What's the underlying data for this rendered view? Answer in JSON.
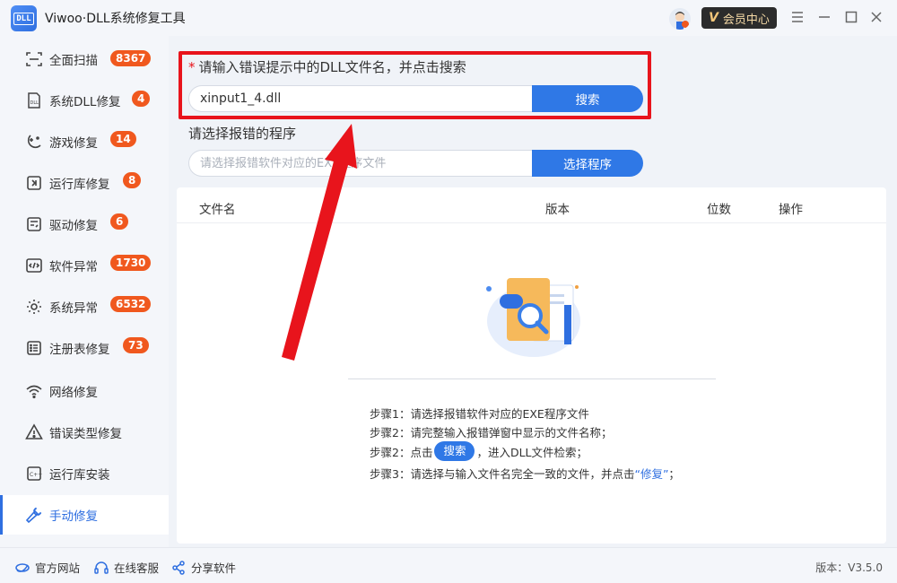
{
  "app": {
    "title": "Viwoo·DLL系统修复工具",
    "logo_text": "DLL"
  },
  "titlebar": {
    "vip_label": "会员中心",
    "vip_mark": "V"
  },
  "sidebar": {
    "items": [
      {
        "label": "全面扫描",
        "badge": "8367",
        "icon": "scan-icon"
      },
      {
        "label": "系统DLL修复",
        "badge": "4",
        "icon": "dll-icon"
      },
      {
        "label": "游戏修复",
        "badge": "14",
        "icon": "gamepad-icon"
      },
      {
        "label": "运行库修复",
        "badge": "8",
        "icon": "runtime-icon"
      },
      {
        "label": "驱动修复",
        "badge": "6",
        "icon": "driver-icon"
      },
      {
        "label": "软件异常",
        "badge": "1730",
        "icon": "code-icon"
      },
      {
        "label": "系统异常",
        "badge": "6532",
        "icon": "gear-icon"
      },
      {
        "label": "注册表修复",
        "badge": "73",
        "icon": "list-icon"
      },
      {
        "label": "网络修复",
        "badge": "",
        "icon": "wifi-icon"
      },
      {
        "label": "错误类型修复",
        "badge": "",
        "icon": "warning-icon"
      },
      {
        "label": "运行库安装",
        "badge": "",
        "icon": "install-icon"
      },
      {
        "label": "手动修复",
        "badge": "",
        "icon": "wrench-icon"
      }
    ]
  },
  "main": {
    "dll_label": "请输入错误提示中的DLL文件名，并点击搜索",
    "dll_required_mark": "*",
    "dll_input_value": "xinput1_4.dll",
    "search_button": "搜索",
    "program_label": "请选择报错的程序",
    "program_placeholder": "请选择报错软件对应的EXE程序文件",
    "select_program_button": "选择程序",
    "table": {
      "headers": [
        "文件名",
        "版本",
        "位数",
        "操作"
      ]
    },
    "steps": {
      "s1": "步骤1：请选择报错软件对应的EXE程序文件",
      "s2": "步骤2：请完整输入报错弹窗中显示的文件名称；",
      "s3_prefix": "步骤2：点击",
      "s3_chip": "搜索",
      "s3_suffix": "，进入DLL文件检索；",
      "s4_prefix": "步骤3：请选择与输入文件名完全一致的文件，并点击",
      "s4_link": "“修复”",
      "s4_suffix": "；"
    }
  },
  "footer": {
    "official_site": "官方网站",
    "online_service": "在线客服",
    "share": "分享软件",
    "version": "版本：V3.5.0"
  },
  "colors": {
    "accent": "#2f78e6",
    "badge": "#f0581e",
    "highlight": "#e8141c"
  }
}
